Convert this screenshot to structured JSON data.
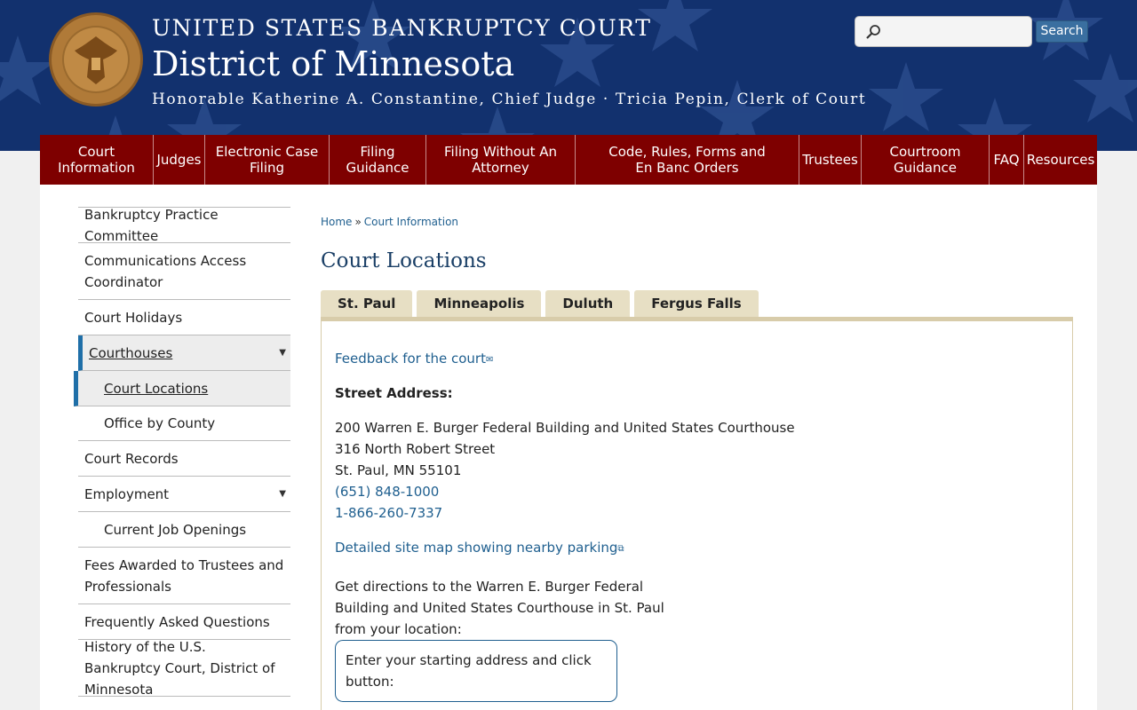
{
  "header": {
    "court_name": "UNITED STATES BANKRUPTCY COURT",
    "district": "District of Minnesota",
    "judges_line": "Honorable Katherine A. Constantine, Chief Judge · Tricia Pepin, Clerk of Court",
    "search_placeholder": "",
    "search_button": "Search",
    "seal_icon": "court-seal-icon"
  },
  "nav": {
    "items": [
      {
        "label": "Court\nInformation"
      },
      {
        "label": "Judges"
      },
      {
        "label": "Electronic Case\nFiling"
      },
      {
        "label": "Filing\nGuidance"
      },
      {
        "label": "Filing Without An\nAttorney"
      },
      {
        "label": "Code, Rules, Forms and\nEn Banc Orders"
      },
      {
        "label": "Trustees"
      },
      {
        "label": "Courtroom\nGuidance"
      },
      {
        "label": "FAQ"
      },
      {
        "label": "Resources"
      }
    ]
  },
  "sidebar": {
    "items": [
      {
        "label": "Bankruptcy Practice Committee"
      },
      {
        "label": "Communications Access Coordinator"
      },
      {
        "label": "Court Holidays"
      },
      {
        "label": "Courthouses"
      },
      {
        "label": "Court Locations"
      },
      {
        "label": "Office by County"
      },
      {
        "label": "Court Records"
      },
      {
        "label": "Employment"
      },
      {
        "label": "Current Job Openings"
      },
      {
        "label": "Fees Awarded to Trustees and Professionals"
      },
      {
        "label": "Frequently Asked Questions"
      },
      {
        "label": "History of the U.S. Bankruptcy Court, District of Minnesota"
      }
    ]
  },
  "breadcrumb": {
    "home": "Home",
    "separator": "»",
    "current": "Court Information"
  },
  "main": {
    "title": "Court Locations",
    "tabs": [
      {
        "label": "St. Paul"
      },
      {
        "label": "Minneapolis"
      },
      {
        "label": "Duluth"
      },
      {
        "label": "Fergus Falls"
      }
    ],
    "feedback_link": "Feedback for the court",
    "street_address_label": "Street Address:",
    "address_line1": "200 Warren E. Burger Federal Building and United States Courthouse",
    "address_line2": "316 North Robert Street",
    "address_line3": "St. Paul, MN 55101",
    "phone1": "(651) 848-1000",
    "phone2": "1-866-260-7337",
    "site_map_link": "Detailed site map showing nearby parking",
    "directions_line1": "Get directions to the Warren E. Burger Federal",
    "directions_line2": "Building and United States Courthouse in St. Paul",
    "directions_line3": "from your location:",
    "address_box_text": "Enter your starting address and click button:"
  },
  "colors": {
    "header_bg": "#12316e",
    "nav_bg": "#7e0000",
    "link": "#1f5f8f",
    "tab_bg": "#e7dfc4",
    "active_marker": "#1f6fa8"
  }
}
